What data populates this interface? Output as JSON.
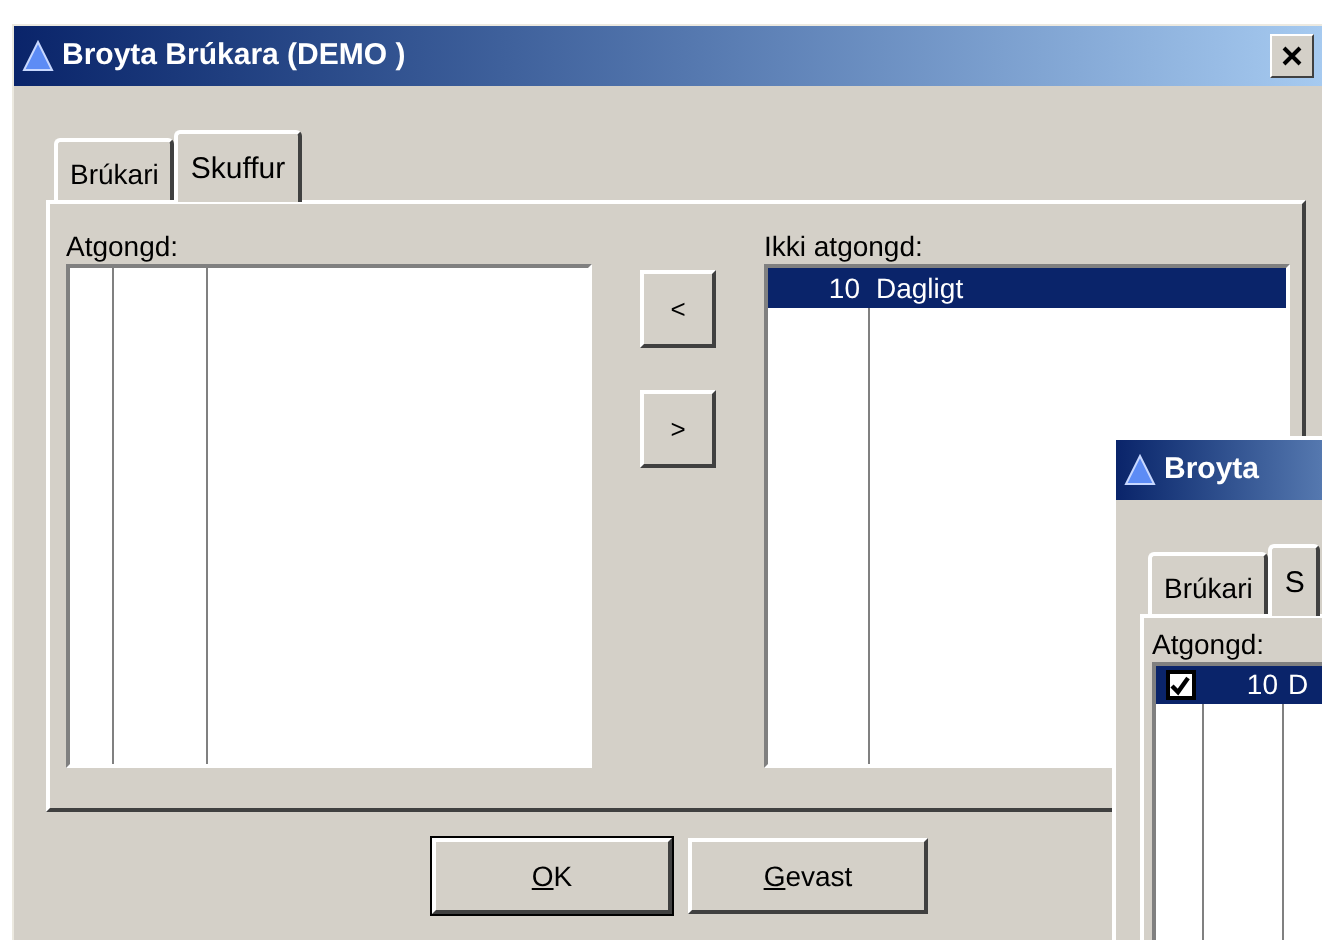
{
  "window": {
    "title": "Broyta Brúkara (DEMO )"
  },
  "tabs": [
    {
      "label": "Brúkari",
      "selected": false
    },
    {
      "label": "Skuffur",
      "selected": true
    }
  ],
  "assigned": {
    "label": "Atgongd:"
  },
  "not_assigned": {
    "label": "Ikki atgongd:",
    "rows": [
      {
        "number": "10",
        "name": "Dagligt",
        "selected": true
      }
    ]
  },
  "move_buttons": [
    "<",
    ">"
  ],
  "buttons": [
    "OK",
    "Gevast"
  ],
  "second_window": {
    "title": "Broyta",
    "tabs": [
      {
        "label": "Brúkari",
        "selected": false
      },
      {
        "label": "S",
        "selected": true
      }
    ],
    "assigned": {
      "label": "Atgongd:",
      "rows": [
        {
          "checked": true,
          "number": "10",
          "name": "D",
          "selected": true
        }
      ]
    }
  }
}
